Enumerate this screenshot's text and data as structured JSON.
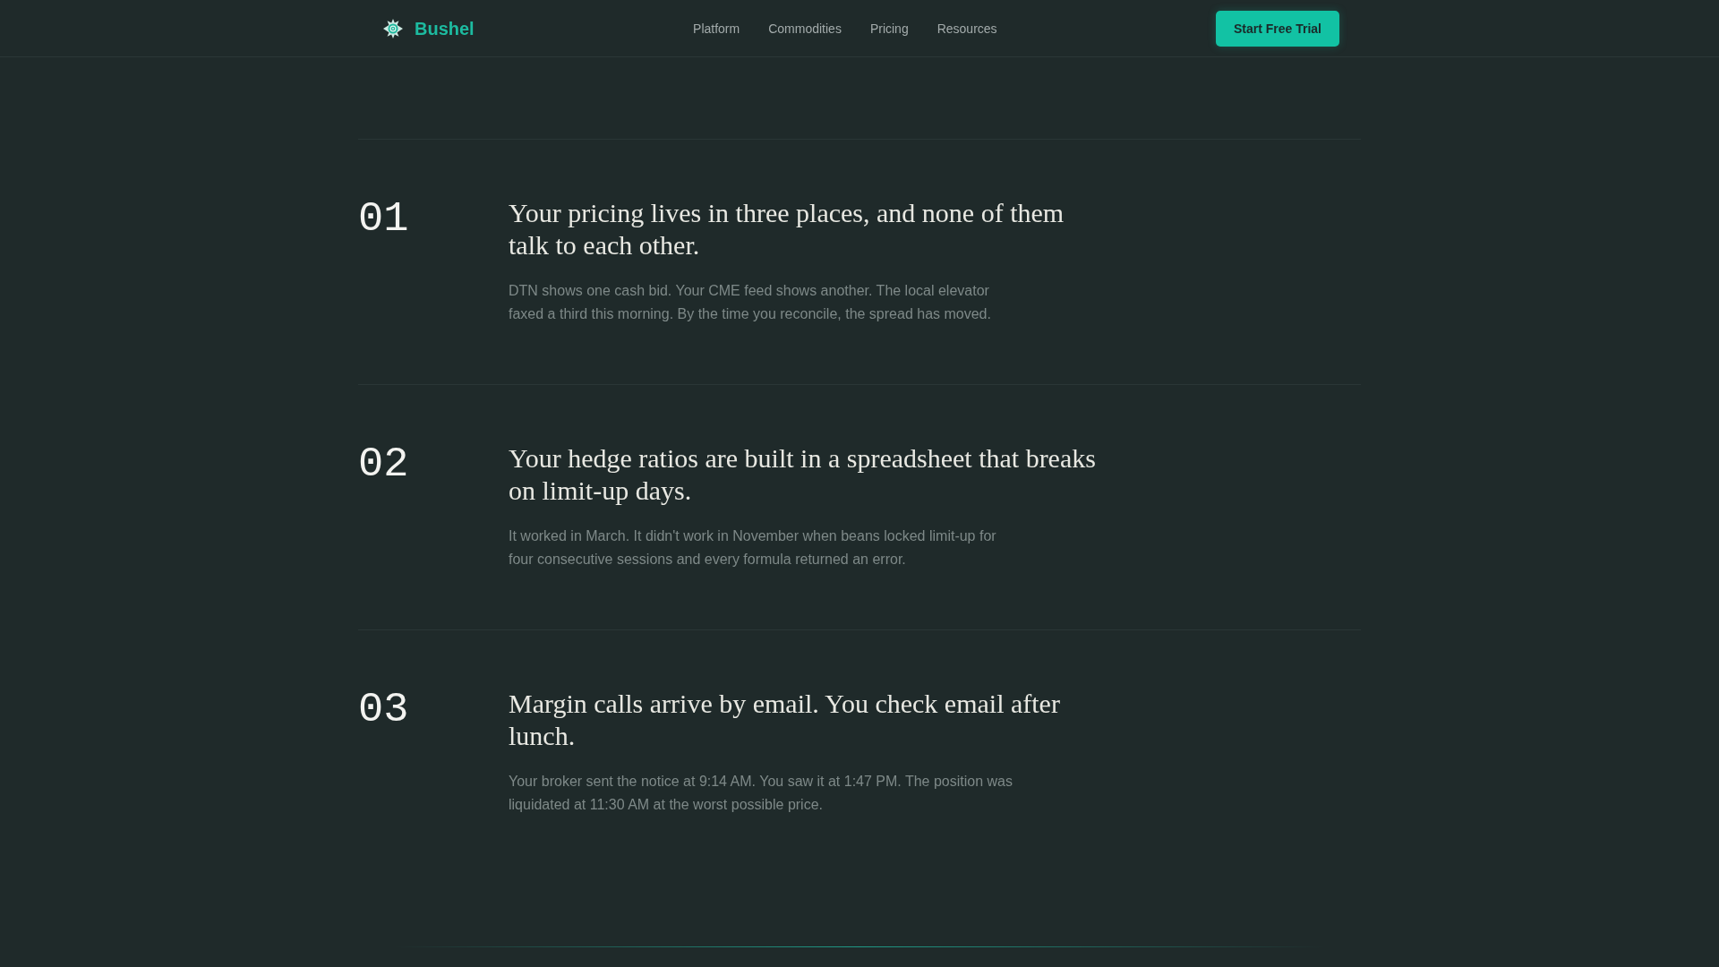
{
  "nav": {
    "brand": "Bushel",
    "links": [
      "Platform",
      "Commodities",
      "Pricing",
      "Resources"
    ],
    "cta": "Start Free Trial"
  },
  "items": [
    {
      "number": "01",
      "title": "Your pricing lives in three places, and none of them talk to each other.",
      "body": "DTN shows one cash bid. Your CME feed shows another. The local elevator faxed a third this morning. By the time you reconcile, the spread has moved."
    },
    {
      "number": "02",
      "title": "Your hedge ratios are built in a spreadsheet that breaks on limit-up days.",
      "body": "It worked in March. It didn't work in November when beans locked limit-up for four consecutive sessions and every formula returned an error."
    },
    {
      "number": "03",
      "title": "Margin calls arrive by email. You check email after lunch.",
      "body": "Your broker sent the notice at 9:14 AM. You saw it at 1:47 PM. The position was liquidated at 11:30 AM at the worst possible price."
    }
  ]
}
